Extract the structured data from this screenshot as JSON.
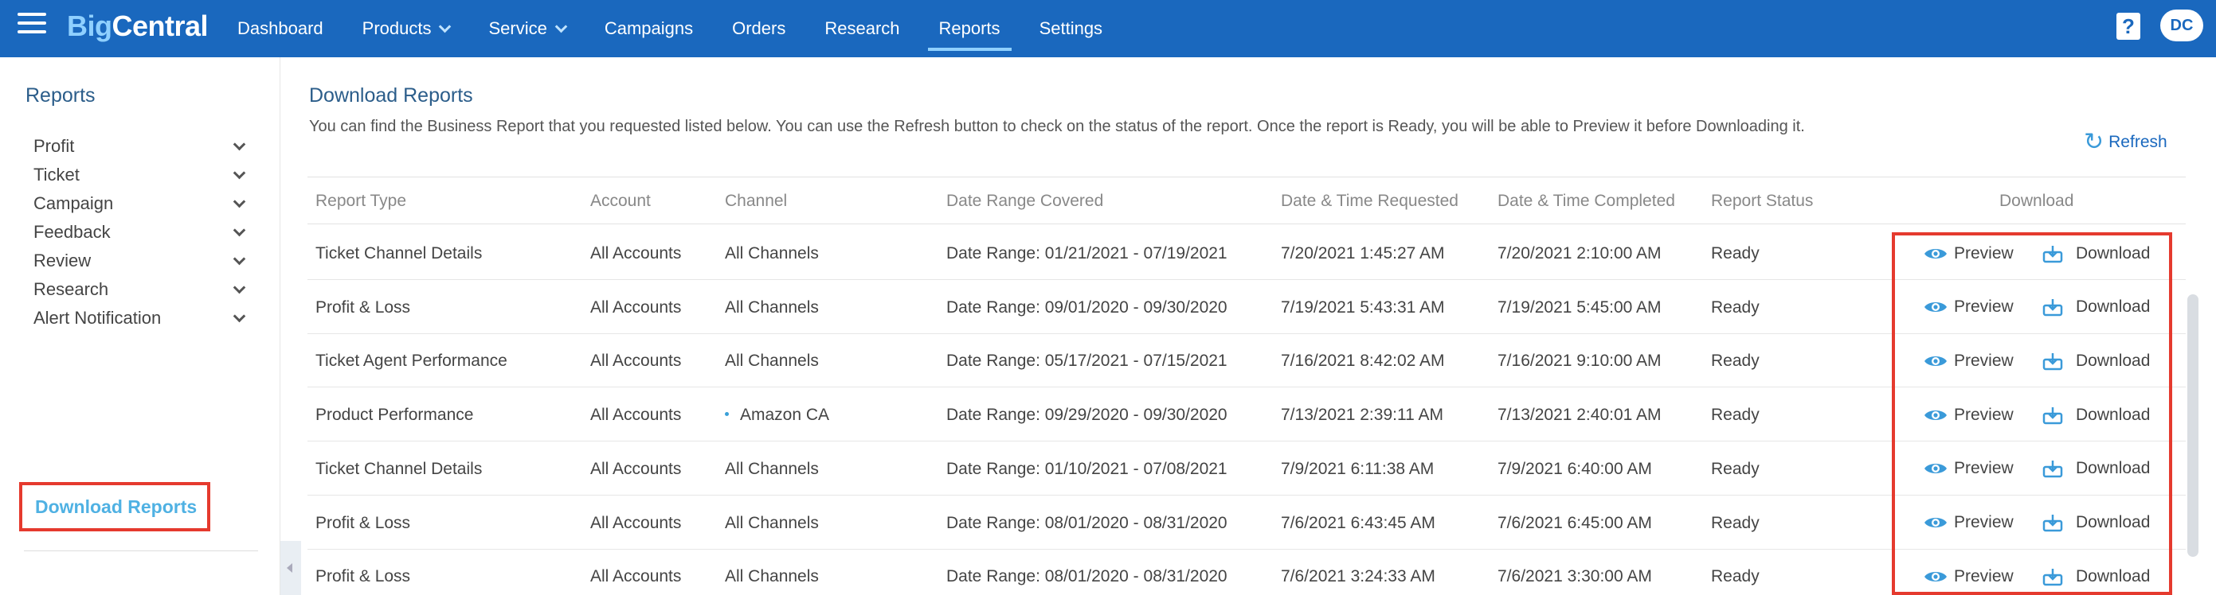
{
  "brand": {
    "logo_part1": "Big",
    "logo_part2": "Central"
  },
  "nav": {
    "items": [
      {
        "label": "Dashboard",
        "dropdown": false,
        "active": false
      },
      {
        "label": "Products",
        "dropdown": true,
        "active": false
      },
      {
        "label": "Service",
        "dropdown": true,
        "active": false
      },
      {
        "label": "Campaigns",
        "dropdown": false,
        "active": false
      },
      {
        "label": "Orders",
        "dropdown": false,
        "active": false
      },
      {
        "label": "Research",
        "dropdown": false,
        "active": false
      },
      {
        "label": "Reports",
        "dropdown": false,
        "active": true
      },
      {
        "label": "Settings",
        "dropdown": false,
        "active": false
      }
    ],
    "help_label": "?",
    "avatar_initials": "DC"
  },
  "sidebar": {
    "title": "Reports",
    "items": [
      {
        "label": "Profit"
      },
      {
        "label": "Ticket"
      },
      {
        "label": "Campaign"
      },
      {
        "label": "Feedback"
      },
      {
        "label": "Review"
      },
      {
        "label": "Research"
      },
      {
        "label": "Alert Notification"
      }
    ],
    "active_item": "Download Reports"
  },
  "main": {
    "title": "Download Reports",
    "description": "You can find the Business Report that you requested listed below. You can use the Refresh button to check on the status of the report. Once the report is Ready, you will be able to Preview it before Downloading it.",
    "refresh_label": "Refresh",
    "table": {
      "headers": [
        "Report Type",
        "Account",
        "Channel",
        "Date Range Covered",
        "Date & Time Requested",
        "Date & Time Completed",
        "Report Status",
        "Download"
      ],
      "preview_label": "Preview",
      "download_label": "Download",
      "rows": [
        {
          "type": "Ticket Channel Details",
          "account": "All Accounts",
          "channel": "All Channels",
          "channel_dot": false,
          "range": "Date Range: 01/21/2021 - 07/19/2021",
          "requested": "7/20/2021 1:45:27 AM",
          "completed": "7/20/2021 2:10:00 AM",
          "status": "Ready"
        },
        {
          "type": "Profit & Loss",
          "account": "All Accounts",
          "channel": "All Channels",
          "channel_dot": false,
          "range": "Date Range: 09/01/2020 - 09/30/2020",
          "requested": "7/19/2021 5:43:31 AM",
          "completed": "7/19/2021 5:45:00 AM",
          "status": "Ready"
        },
        {
          "type": "Ticket Agent Performance",
          "account": "All Accounts",
          "channel": "All Channels",
          "channel_dot": false,
          "range": "Date Range: 05/17/2021 - 07/15/2021",
          "requested": "7/16/2021 8:42:02 AM",
          "completed": "7/16/2021 9:10:00 AM",
          "status": "Ready"
        },
        {
          "type": "Product Performance",
          "account": "All Accounts",
          "channel": "Amazon CA",
          "channel_dot": true,
          "range": "Date Range: 09/29/2020 - 09/30/2020",
          "requested": "7/13/2021 2:39:11 AM",
          "completed": "7/13/2021 2:40:01 AM",
          "status": "Ready"
        },
        {
          "type": "Ticket Channel Details",
          "account": "All Accounts",
          "channel": "All Channels",
          "channel_dot": false,
          "range": "Date Range: 01/10/2021 - 07/08/2021",
          "requested": "7/9/2021 6:11:38 AM",
          "completed": "7/9/2021 6:40:00 AM",
          "status": "Ready"
        },
        {
          "type": "Profit & Loss",
          "account": "All Accounts",
          "channel": "All Channels",
          "channel_dot": false,
          "range": "Date Range: 08/01/2020 - 08/31/2020",
          "requested": "7/6/2021 6:43:45 AM",
          "completed": "7/6/2021 6:45:00 AM",
          "status": "Ready"
        },
        {
          "type": "Profit & Loss",
          "account": "All Accounts",
          "channel": "All Channels",
          "channel_dot": false,
          "range": "Date Range: 08/01/2020 - 08/31/2020",
          "requested": "7/6/2021 3:24:33 AM",
          "completed": "7/6/2021 3:30:00 AM",
          "status": "Ready"
        }
      ]
    }
  },
  "colors": {
    "nav_bg": "#1a68be",
    "accent": "#4fb1e3",
    "highlight": "#e53a2e"
  }
}
